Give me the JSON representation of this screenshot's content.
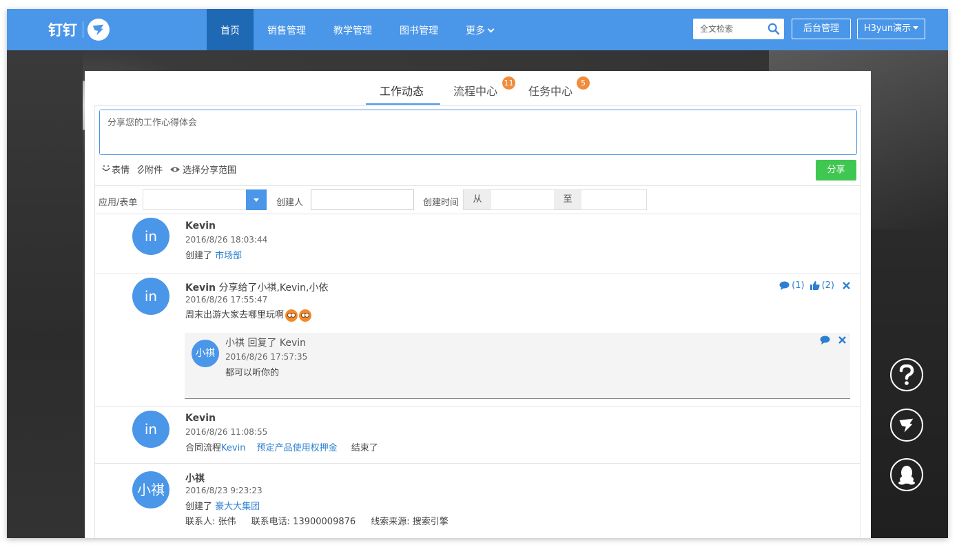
{
  "header": {
    "logo_text": "钉钉",
    "nav": [
      {
        "label": "首页",
        "active": true
      },
      {
        "label": "销售管理"
      },
      {
        "label": "教学管理"
      },
      {
        "label": "图书管理"
      },
      {
        "label": "更多"
      }
    ],
    "search_placeholder": "全文检索",
    "admin_label": "后台管理",
    "user_label": "H3yun演示"
  },
  "tabs": [
    {
      "label": "工作动态",
      "badge": ""
    },
    {
      "label": "流程中心",
      "badge": "11"
    },
    {
      "label": "任务中心",
      "badge": "5"
    }
  ],
  "composer": {
    "placeholder": "分享您的工作心得体会",
    "emoji_label": "表情",
    "attach_label": "附件",
    "scope_label": "选择分享范围",
    "share_label": "分享"
  },
  "filters": {
    "app_label": "应用/表单",
    "creator_label": "创建人",
    "time_label": "创建时间",
    "from_label": "从",
    "to_label": "至"
  },
  "feed": [
    {
      "avatar": "in",
      "name": "Kevin",
      "time": "2016/8/26 18:03:44",
      "prefix": "创建了 ",
      "link": "市场部"
    },
    {
      "avatar": "in",
      "name": "Kevin",
      "share_text": " 分享给了小祺,Kevin,小依",
      "time": "2016/8/26 17:55:47",
      "content": "周末出游大家去哪里玩啊",
      "comments": "(1)",
      "likes": "(2)",
      "reply": {
        "avatar": "小祺",
        "title": "小祺 回复了 Kevin",
        "time": "2016/8/26 17:57:35",
        "content": "都可以听你的"
      }
    },
    {
      "avatar": "in",
      "name": "Kevin",
      "time": "2016/8/26 11:08:55",
      "prefix": "合同流程",
      "link": "Kevin",
      "link2": "预定产品使用权押金",
      "suffix": "结束了"
    },
    {
      "avatar": "小祺",
      "name": "小祺",
      "time": "2016/8/23 9:23:23",
      "prefix": "创建了 ",
      "link": "豪大大集团",
      "contact": "联系人: 张伟",
      "phone": "联系电话: 13900009876",
      "source": "线索来源: 搜索引擎"
    }
  ]
}
